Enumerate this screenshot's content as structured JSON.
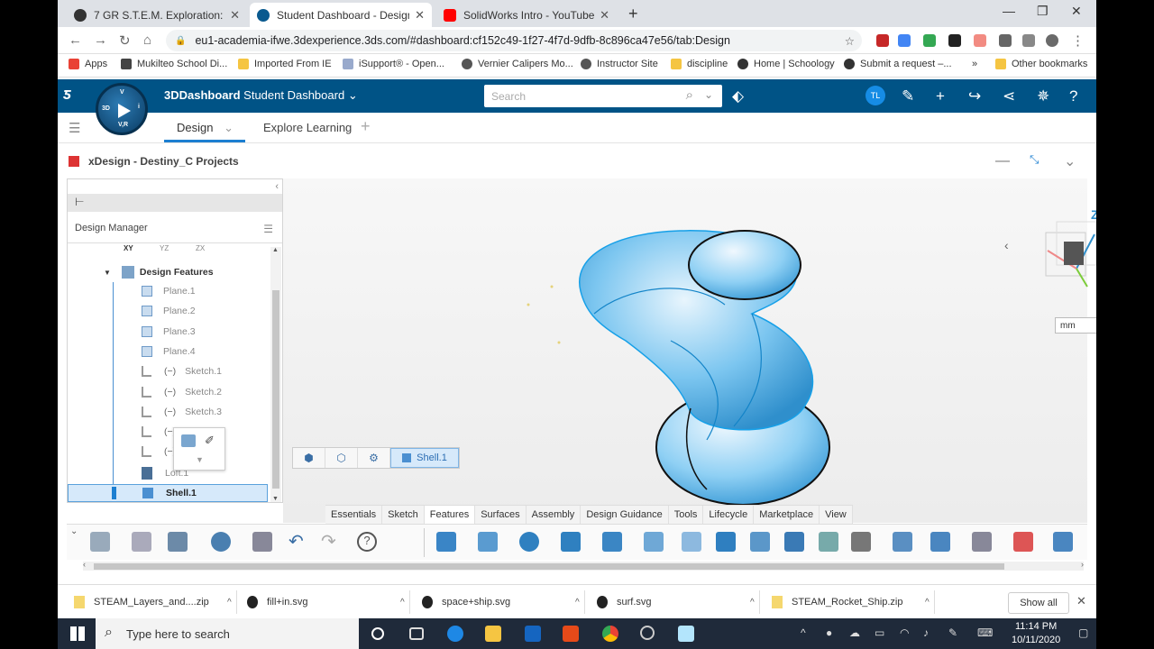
{
  "browser": {
    "tabs": [
      {
        "title": "7 GR S.T.E.M. Exploration: 7 GR S",
        "active": false,
        "fav_color": "#333333"
      },
      {
        "title": "Student Dashboard - Design",
        "active": true,
        "fav_color": "#0a5a8f"
      },
      {
        "title": "SolidWorks Intro - YouTube",
        "active": false,
        "fav_color": "#ff0000"
      }
    ],
    "url": "eu1-academia-ifwe.3dexperience.3ds.com/#dashboard:cf152c49-1f27-4f7d-9dfb-8c896ca47e56/tab:Design",
    "bookmarks": [
      "Apps",
      "Mukilteo School Di...",
      "Imported From IE",
      "iSupport® - Open...",
      "Vernier Calipers Mo...",
      "Instructor Site",
      "discipline",
      "Home | Schoology",
      "Submit a request –...",
      "»",
      "Other bookmarks"
    ]
  },
  "dashboard": {
    "brand_bold": "3DDashboard",
    "brand_name": "Student Dashboard",
    "search_placeholder": "Search",
    "user_initials": "TL",
    "compass": {
      "top": "V,R",
      "left": "3D",
      "right": "i",
      "top_label": "V"
    },
    "tabs": [
      {
        "label": "Design",
        "active": true
      },
      {
        "label": "Explore Learning",
        "active": false
      }
    ]
  },
  "app": {
    "title": "xDesign - Destiny_C Projects",
    "design_manager": {
      "title": "Design Manager",
      "axes": [
        "XY",
        "YZ",
        "ZX"
      ],
      "root": "Design Features",
      "items": [
        {
          "label": "Plane.1",
          "kind": "plane"
        },
        {
          "label": "Plane.2",
          "kind": "plane"
        },
        {
          "label": "Plane.3",
          "kind": "plane"
        },
        {
          "label": "Plane.4",
          "kind": "plane"
        },
        {
          "label": "Sketch.1",
          "kind": "sketch"
        },
        {
          "label": "Sketch.2",
          "kind": "sketch"
        },
        {
          "label": "Sketch.3",
          "kind": "sketch"
        },
        {
          "label": "",
          "kind": "sketch"
        },
        {
          "label": "",
          "kind": "sketch"
        },
        {
          "label": "Loft.1",
          "kind": "loft"
        }
      ],
      "selected": "Shell.1"
    },
    "context_toolbar_label": "Shell.1",
    "units": "mm",
    "command_tabs": [
      {
        "label": "Essentials",
        "active": false
      },
      {
        "label": "Sketch",
        "active": false
      },
      {
        "label": "Features",
        "active": true
      },
      {
        "label": "Surfaces",
        "active": false
      },
      {
        "label": "Assembly",
        "active": false
      },
      {
        "label": "Design Guidance",
        "active": false
      },
      {
        "label": "Tools",
        "active": false
      },
      {
        "label": "Lifecycle",
        "active": false
      },
      {
        "label": "Marketplace",
        "active": false
      },
      {
        "label": "View",
        "active": false
      }
    ],
    "triad_label": "Z"
  },
  "downloads": [
    {
      "name": "STEAM_Layers_and....zip",
      "type": "zip"
    },
    {
      "name": "fill+in.svg",
      "type": "svg"
    },
    {
      "name": "space+ship.svg",
      "type": "svg"
    },
    {
      "name": "surf.svg",
      "type": "svg"
    },
    {
      "name": "STEAM_Rocket_Ship.zip",
      "type": "zip"
    }
  ],
  "downloads_show_all": "Show all",
  "taskbar": {
    "search_placeholder": "Type here to search",
    "time": "11:14 PM",
    "date": "10/11/2020"
  },
  "colors": {
    "brand_blue": "#005386",
    "accent": "#1c7fd1",
    "shape": "#5db8ec"
  }
}
